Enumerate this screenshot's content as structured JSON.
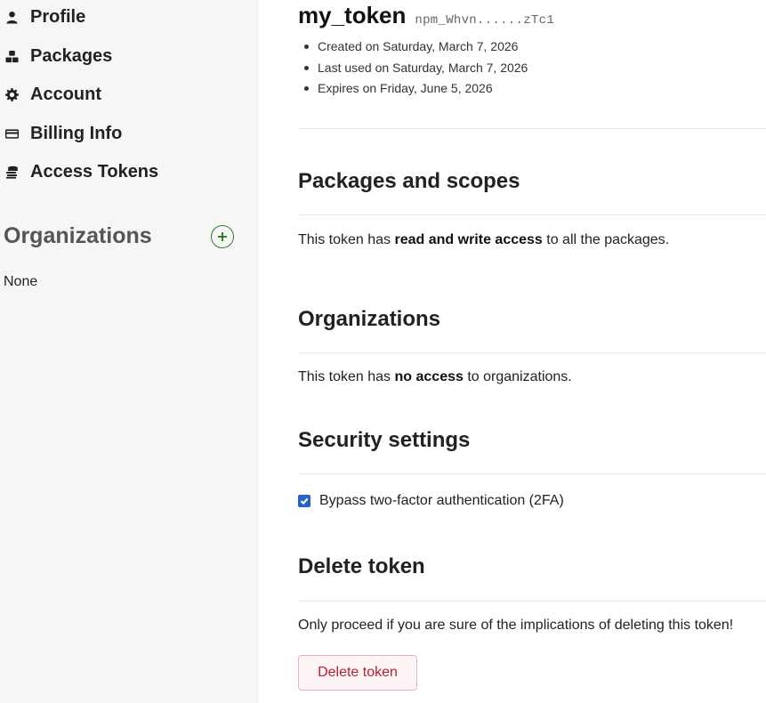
{
  "sidebar": {
    "items": [
      {
        "label": "Profile",
        "icon": "user-icon"
      },
      {
        "label": "Packages",
        "icon": "packages-icon"
      },
      {
        "label": "Account",
        "icon": "gear-icon"
      },
      {
        "label": "Billing Info",
        "icon": "credit-card-icon"
      },
      {
        "label": "Access Tokens",
        "icon": "coins-icon"
      }
    ],
    "organizations": {
      "heading": "Organizations",
      "add_icon": "plus-circle-icon",
      "empty_text": "None"
    }
  },
  "token": {
    "name": "my_token",
    "code": "npm_Whvn......zTc1",
    "meta": [
      "Created on Saturday, March 7, 2026",
      "Last used on Saturday, March 7, 2026",
      "Expires on Friday, June 5, 2026"
    ]
  },
  "packages_scopes": {
    "title": "Packages and scopes",
    "text_prefix": "This token has ",
    "text_bold": "read and write access",
    "text_suffix": " to all the packages."
  },
  "organizations_section": {
    "title": "Organizations",
    "text_prefix": "This token has ",
    "text_bold": "no access",
    "text_suffix": " to organizations."
  },
  "security": {
    "title": "Security settings",
    "checkbox_label": "Bypass two-factor authentication (2FA)",
    "checked": true
  },
  "delete": {
    "title": "Delete token",
    "warning": "Only proceed if you are sure of the implications of deleting this token!",
    "button_label": "Delete token"
  },
  "colors": {
    "accent_green": "#2f7d2f",
    "checkbox_blue": "#2563c9",
    "danger_red": "#b3222f"
  }
}
